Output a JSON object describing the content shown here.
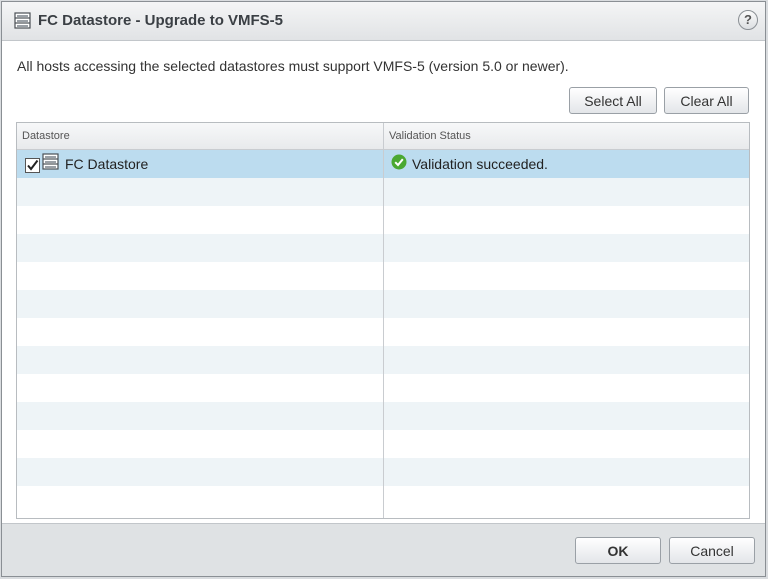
{
  "dialog": {
    "title": "FC Datastore - Upgrade to VMFS-5",
    "help_label": "?",
    "message": "All hosts accessing the selected datastores must support VMFS-5 (version 5.0 or newer).",
    "select_all_label": "Select All",
    "clear_all_label": "Clear All",
    "ok_label": "OK",
    "cancel_label": "Cancel"
  },
  "table": {
    "columns": [
      "Datastore",
      "Validation Status"
    ],
    "rows": [
      {
        "name": "FC Datastore",
        "checked": true,
        "selected": true,
        "status": "Validation succeeded.",
        "status_icon": "check-circle-icon"
      }
    ]
  },
  "colors": {
    "selected_row": "#bcdcef",
    "alt_row": "#eef4f7",
    "success_green": "#4aa832"
  }
}
